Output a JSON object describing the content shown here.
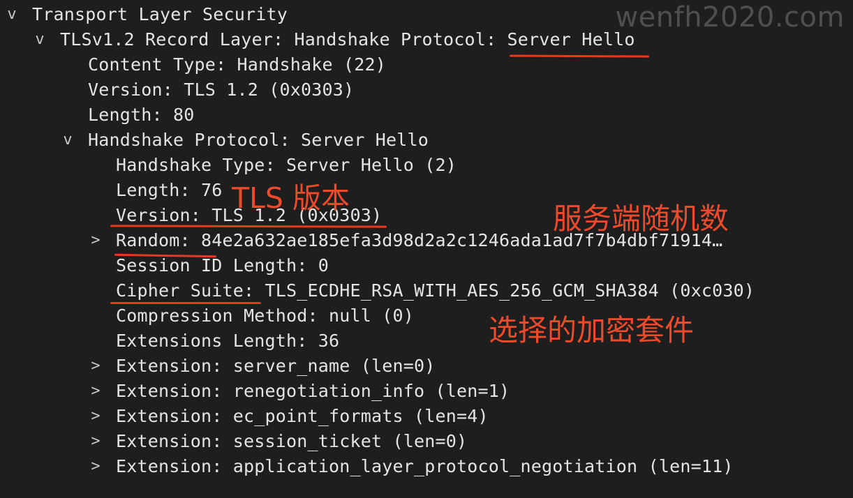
{
  "watermark": "wenfh2020.com",
  "tree": {
    "rows": [
      {
        "text": "Transport Layer Security",
        "toggle": "v"
      },
      {
        "text": "TLSv1.2 Record Layer: Handshake Protocol: Server Hello",
        "toggle": "v"
      },
      {
        "text": "Content Type: Handshake (22)"
      },
      {
        "text": "Version: TLS 1.2 (0x0303)"
      },
      {
        "text": "Length: 80"
      },
      {
        "text": "Handshake Protocol: Server Hello",
        "toggle": "v"
      },
      {
        "text": "Handshake Type: Server Hello (2)"
      },
      {
        "text": "Length: 76"
      },
      {
        "text": "Version: TLS 1.2 (0x0303)"
      },
      {
        "text": "Random: 84e2a632ae185efa3d98d2a2c1246ada1ad7f7b4dbf71914…",
        "toggle": ">"
      },
      {
        "text": "Session ID Length: 0"
      },
      {
        "text": "Cipher Suite: TLS_ECDHE_RSA_WITH_AES_256_GCM_SHA384 (0xc030)"
      },
      {
        "text": "Compression Method: null (0)"
      },
      {
        "text": "Extensions Length: 36"
      },
      {
        "text": "Extension: server_name (len=0)",
        "toggle": ">"
      },
      {
        "text": "Extension: renegotiation_info (len=1)",
        "toggle": ">"
      },
      {
        "text": "Extension: ec_point_formats (len=4)",
        "toggle": ">"
      },
      {
        "text": "Extension: session_ticket (len=0)",
        "toggle": ">"
      },
      {
        "text": "Extension: application_layer_protocol_negotiation (len=11)",
        "toggle": ">"
      }
    ]
  },
  "annotations": {
    "tls_version": "TLS 版本",
    "server_random": "服务端随机数",
    "cipher_suite": "选择的加密套件"
  },
  "colors": {
    "background": "#1e1e1e",
    "text": "#e4e4e4",
    "annotation": "#ec4a2a"
  }
}
